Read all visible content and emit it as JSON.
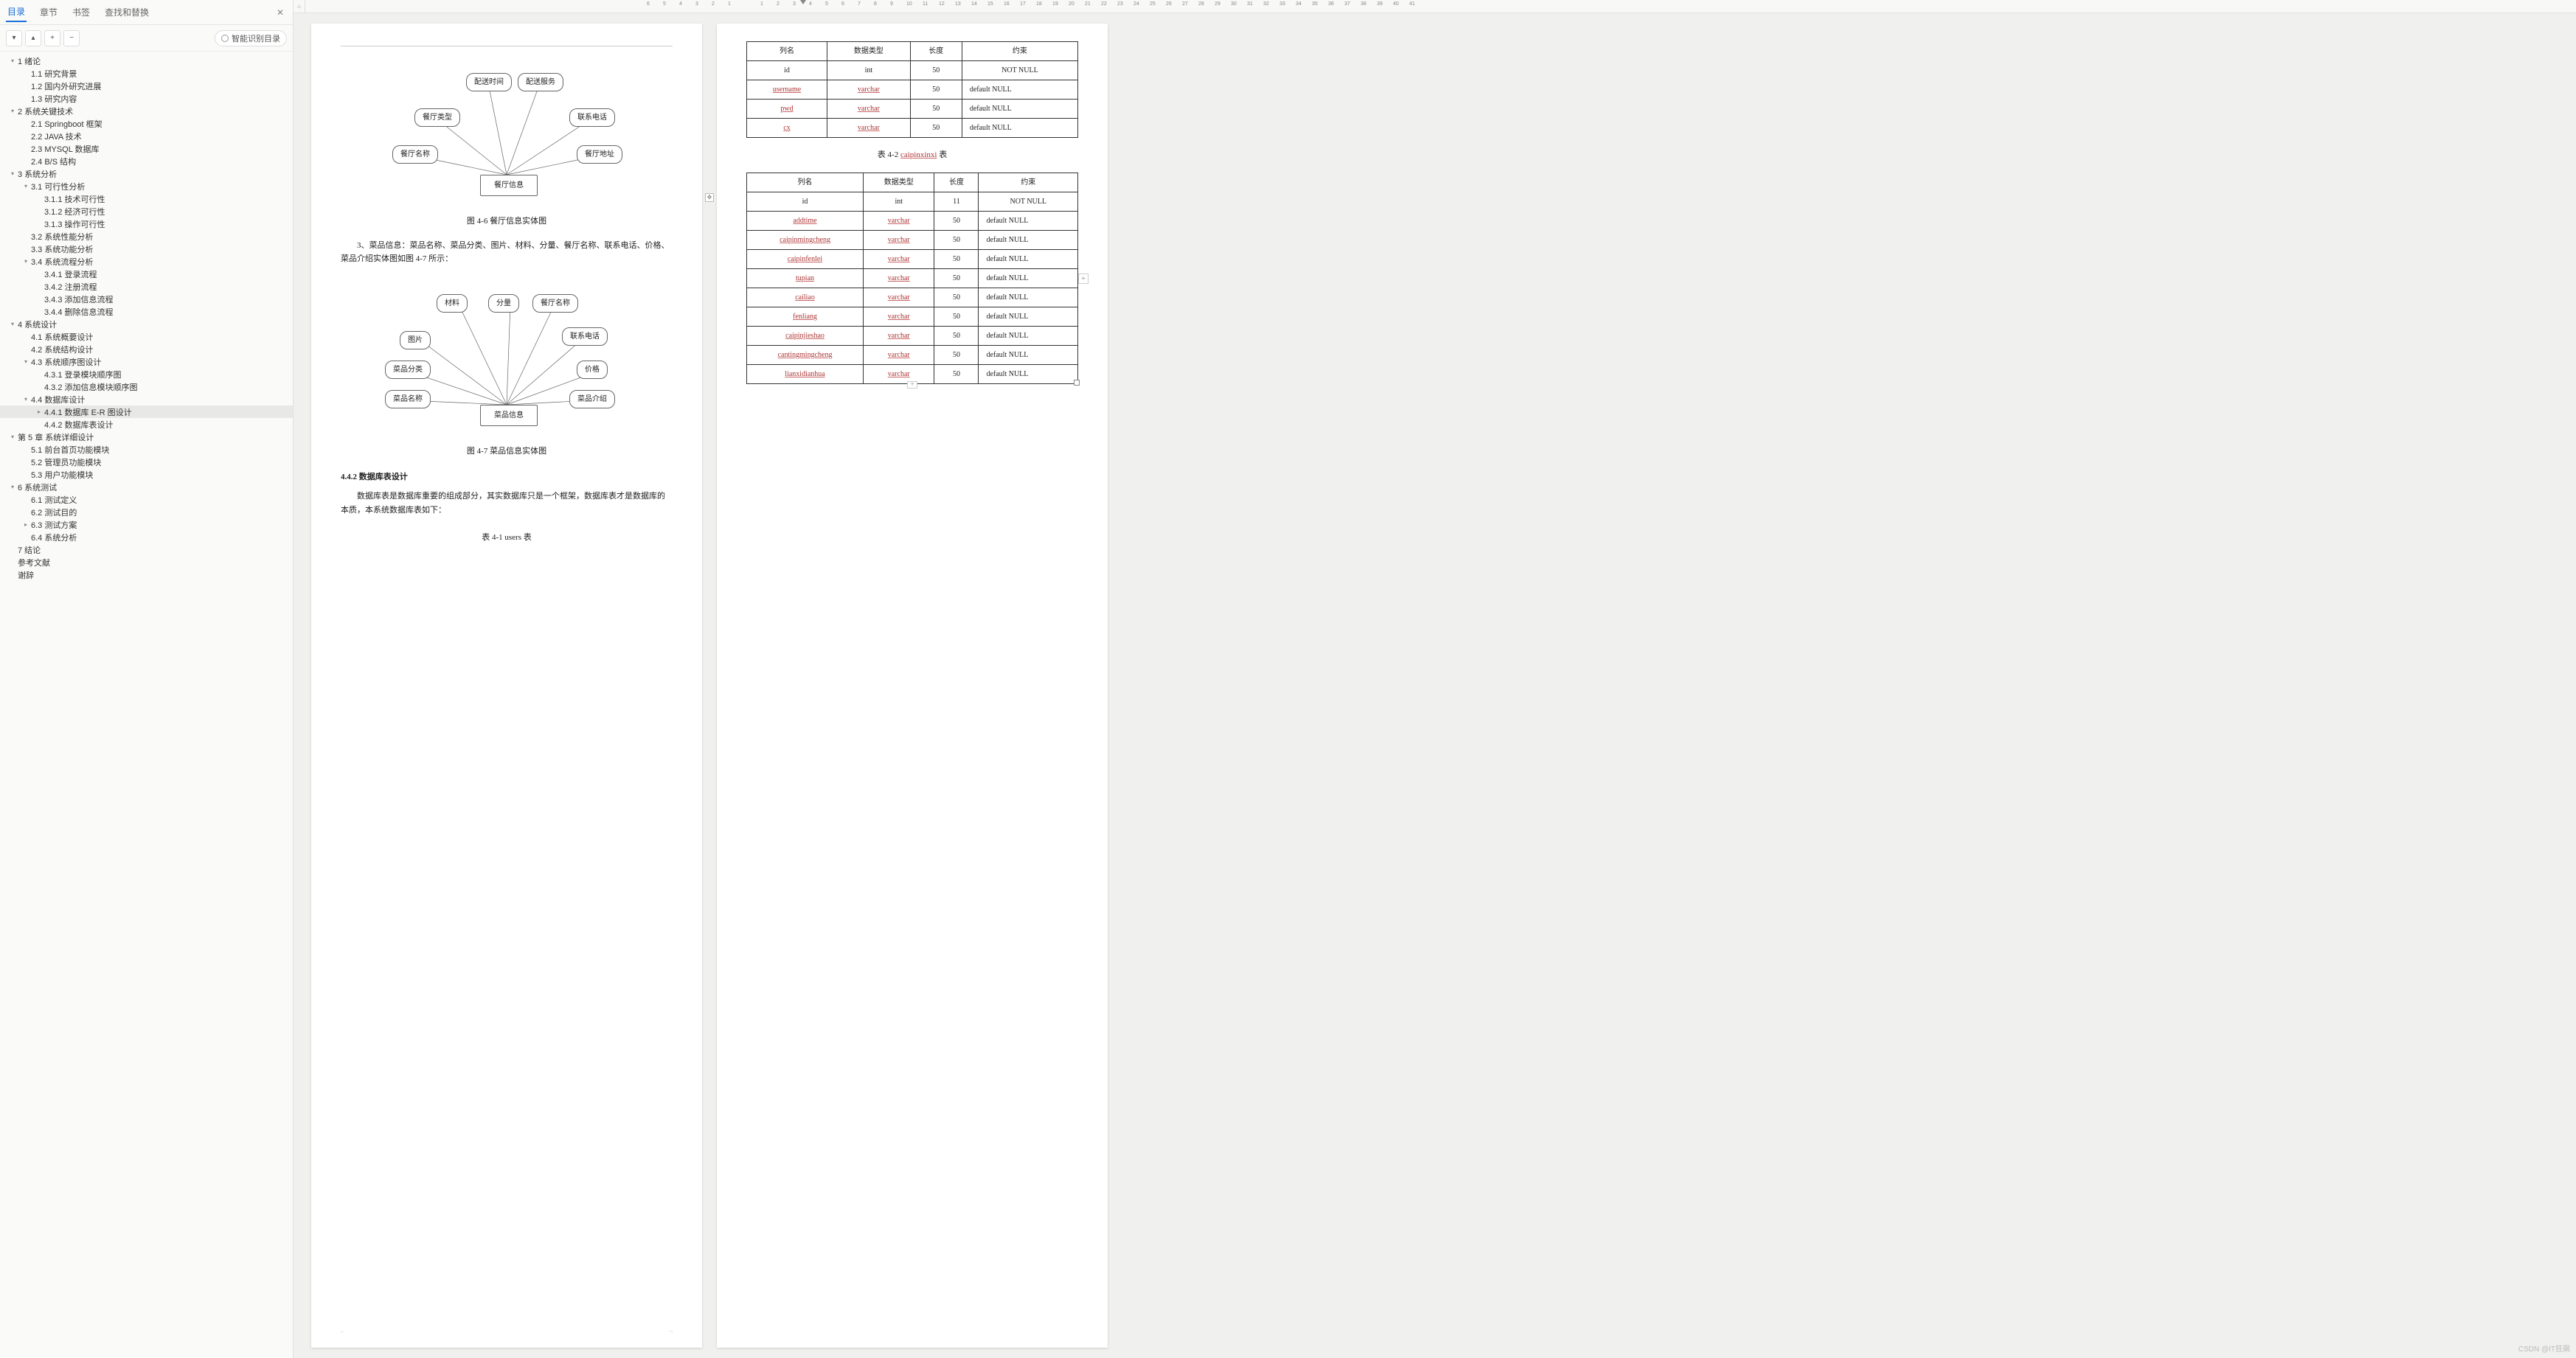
{
  "sidebar": {
    "tabs": {
      "toc": "目录",
      "chapters": "章节",
      "bookmarks": "书签",
      "findreplace": "查找和替换"
    },
    "aiBtn": "智能识别目录",
    "toolbarIcons": {
      "down": "▾",
      "up": "▴",
      "plus": "+",
      "minus": "−"
    }
  },
  "outline": [
    {
      "t": "1 绪论",
      "lv": 0,
      "tw": "▾"
    },
    {
      "t": "1.1 研究背景",
      "lv": 1
    },
    {
      "t": "1.2 国内外研究进展",
      "lv": 1
    },
    {
      "t": "1.3 研究内容",
      "lv": 1
    },
    {
      "t": "2 系统关键技术",
      "lv": 0,
      "tw": "▾"
    },
    {
      "t": "2.1 Springboot 框架",
      "lv": 1
    },
    {
      "t": "2.2 JAVA 技术",
      "lv": 1
    },
    {
      "t": "2.3 MYSQL 数据库",
      "lv": 1
    },
    {
      "t": "2.4 B/S 结构",
      "lv": 1
    },
    {
      "t": "3 系统分析",
      "lv": 0,
      "tw": "▾"
    },
    {
      "t": "3.1 可行性分析",
      "lv": 1,
      "tw": "▾"
    },
    {
      "t": "3.1.1 技术可行性",
      "lv": 2
    },
    {
      "t": "3.1.2 经济可行性",
      "lv": 2
    },
    {
      "t": "3.1.3 操作可行性",
      "lv": 2
    },
    {
      "t": "3.2 系统性能分析",
      "lv": 1
    },
    {
      "t": "3.3 系统功能分析",
      "lv": 1
    },
    {
      "t": "3.4 系统流程分析",
      "lv": 1,
      "tw": "▾"
    },
    {
      "t": "3.4.1 登录流程",
      "lv": 2
    },
    {
      "t": "3.4.2 注册流程",
      "lv": 2
    },
    {
      "t": "3.4.3 添加信息流程",
      "lv": 2
    },
    {
      "t": "3.4.4 删除信息流程",
      "lv": 2
    },
    {
      "t": "4 系统设计",
      "lv": 0,
      "tw": "▾"
    },
    {
      "t": "4.1 系统概要设计",
      "lv": 1
    },
    {
      "t": "4.2 系统结构设计",
      "lv": 1
    },
    {
      "t": "4.3 系统顺序图设计",
      "lv": 1,
      "tw": "▾"
    },
    {
      "t": "4.3.1 登录模块顺序图",
      "lv": 2
    },
    {
      "t": "4.3.2 添加信息模块顺序图",
      "lv": 2
    },
    {
      "t": "4.4 数据库设计",
      "lv": 1,
      "tw": "▾"
    },
    {
      "t": "4.4.1 数据库 E-R 图设计",
      "lv": 2,
      "hl": true,
      "tw": "▸"
    },
    {
      "t": "4.4.2 数据库表设计",
      "lv": 2
    },
    {
      "t": "第 5 章 系统详细设计",
      "lv": 0,
      "tw": "▾"
    },
    {
      "t": "5.1 前台首页功能模块",
      "lv": 1
    },
    {
      "t": "5.2 管理员功能模块",
      "lv": 1
    },
    {
      "t": "5.3 用户功能模块",
      "lv": 1
    },
    {
      "t": "6 系统测试",
      "lv": 0,
      "tw": "▾"
    },
    {
      "t": "6.1 测试定义",
      "lv": 1
    },
    {
      "t": "6.2 测试目的",
      "lv": 1
    },
    {
      "t": "6.3 测试方案",
      "lv": 1,
      "tw": "▸"
    },
    {
      "t": "6.4 系统分析",
      "lv": 1
    },
    {
      "t": "7 结论",
      "lv": 0
    },
    {
      "t": "参考文献",
      "lv": 0
    },
    {
      "t": "谢辞",
      "lv": 0
    }
  ],
  "pageL": {
    "er1": {
      "center": "餐厅信息",
      "nodes": [
        "餐厅名称",
        "餐厅类型",
        "配送时间",
        "配送服务",
        "联系电话",
        "餐厅地址"
      ],
      "caption": "图 4-6 餐厅信息实体图"
    },
    "para1_lead": "3、菜品信息：",
    "para1_body": "菜品名称、菜品分类、图片、材料、分量、餐厅名称、联系电话、价格、菜品介绍实体图如图 4-7 所示：",
    "er2": {
      "center": "菜品信息",
      "nodes": [
        "菜品名称",
        "菜品分类",
        "图片",
        "材料",
        "分量",
        "餐厅名称",
        "联系电话",
        "价格",
        "菜品介绍"
      ],
      "caption": "图 4-7 菜品信息实体图"
    },
    "sec442": "4.4.2 数据库表设计",
    "para2": "数据库表是数据库重要的组成部分，其实数据库只是一个框架，数据库表才是数据库的本质，本系统数据库表如下：",
    "tbl1cap": "表 4-1 users 表"
  },
  "pageR": {
    "tbl1": {
      "head": [
        "列名",
        "数据类型",
        "长度",
        "约束"
      ],
      "rows": [
        {
          "c": [
            "id",
            "int",
            "50",
            "NOT NULL"
          ]
        },
        {
          "c": [
            "username",
            "varchar",
            "50",
            "default NULL"
          ],
          "r0": true,
          "r1": true
        },
        {
          "c": [
            "pwd",
            "varchar",
            "50",
            "default NULL"
          ],
          "r0": true,
          "r1": true
        },
        {
          "c": [
            "cx",
            "varchar",
            "50",
            "default NULL"
          ],
          "r0": true,
          "r1": true
        }
      ]
    },
    "tbl2cap_a": "表 4-2 ",
    "tbl2cap_b": "caipinxinxi",
    "tbl2cap_c": " 表",
    "tbl2": {
      "head": [
        "列名",
        "数据类型",
        "长度",
        "约束"
      ],
      "rows": [
        {
          "c": [
            "id",
            "int",
            "11",
            "NOT NULL"
          ]
        },
        {
          "c": [
            "addtime",
            "varchar",
            "50",
            "default NULL"
          ],
          "r0": true,
          "r1": true
        },
        {
          "c": [
            "caipinmingcheng",
            "varchar",
            "50",
            "default NULL"
          ],
          "r0": true,
          "r1": true
        },
        {
          "c": [
            "caipinfenlei",
            "varchar",
            "50",
            "default NULL"
          ],
          "r0": true,
          "r1": true
        },
        {
          "c": [
            "tupian",
            "varchar",
            "50",
            "default NULL"
          ],
          "r0": true,
          "r1": true
        },
        {
          "c": [
            "cailiao",
            "varchar",
            "50",
            "default NULL"
          ],
          "r0": true,
          "r1": true
        },
        {
          "c": [
            "fenliang",
            "varchar",
            "50",
            "default NULL"
          ],
          "r0": true,
          "r1": true
        },
        {
          "c": [
            "caipinjieshao",
            "varchar",
            "50",
            "default NULL"
          ],
          "r0": true,
          "r1": true
        },
        {
          "c": [
            "cantingmingcheng",
            "varchar",
            "50",
            "default NULL"
          ],
          "r0": true,
          "r1": true
        },
        {
          "c": [
            "lianxidianhua",
            "varchar",
            "50",
            "default NULL"
          ],
          "r0": true,
          "r1": true
        }
      ]
    }
  },
  "rulerTicks": [
    "6",
    "5",
    "4",
    "3",
    "2",
    "1",
    "",
    "1",
    "2",
    "3",
    "4",
    "5",
    "6",
    "7",
    "8",
    "9",
    "10",
    "11",
    "12",
    "13",
    "14",
    "15",
    "16",
    "17",
    "18",
    "19",
    "20",
    "21",
    "22",
    "23",
    "24",
    "25",
    "26",
    "27",
    "28",
    "29",
    "30",
    "31",
    "32",
    "33",
    "34",
    "35",
    "36",
    "37",
    "38",
    "39",
    "40",
    "41"
  ],
  "watermark": "CSDN @IT狂飙"
}
